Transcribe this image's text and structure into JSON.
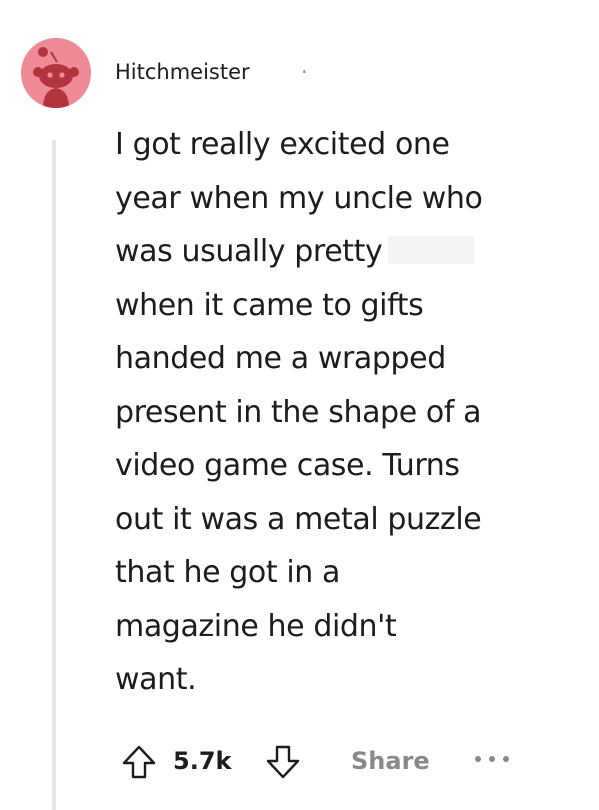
{
  "comment": {
    "author": "Hitchmeister",
    "separator": "·",
    "body_lines": [
      "I got really excited one",
      "year when my uncle who",
      "was usually pretty",
      "when it came to gifts",
      "handed me a wrapped",
      "present in the shape of a",
      "video game case. Turns",
      "out it was a metal puzzle",
      "that he got in a",
      "magazine he didn't",
      "want."
    ]
  },
  "actions": {
    "vote_count": "5.7k",
    "share_label": "Share",
    "upvote_icon": "upvote-arrow-icon",
    "downvote_icon": "downvote-arrow-icon",
    "more_icon": "more-options-icon"
  },
  "colors": {
    "avatar_bg": "#f08a96",
    "text": "#1c1c1c",
    "muted": "#878a8c",
    "thread_line": "#e5e5e5"
  }
}
